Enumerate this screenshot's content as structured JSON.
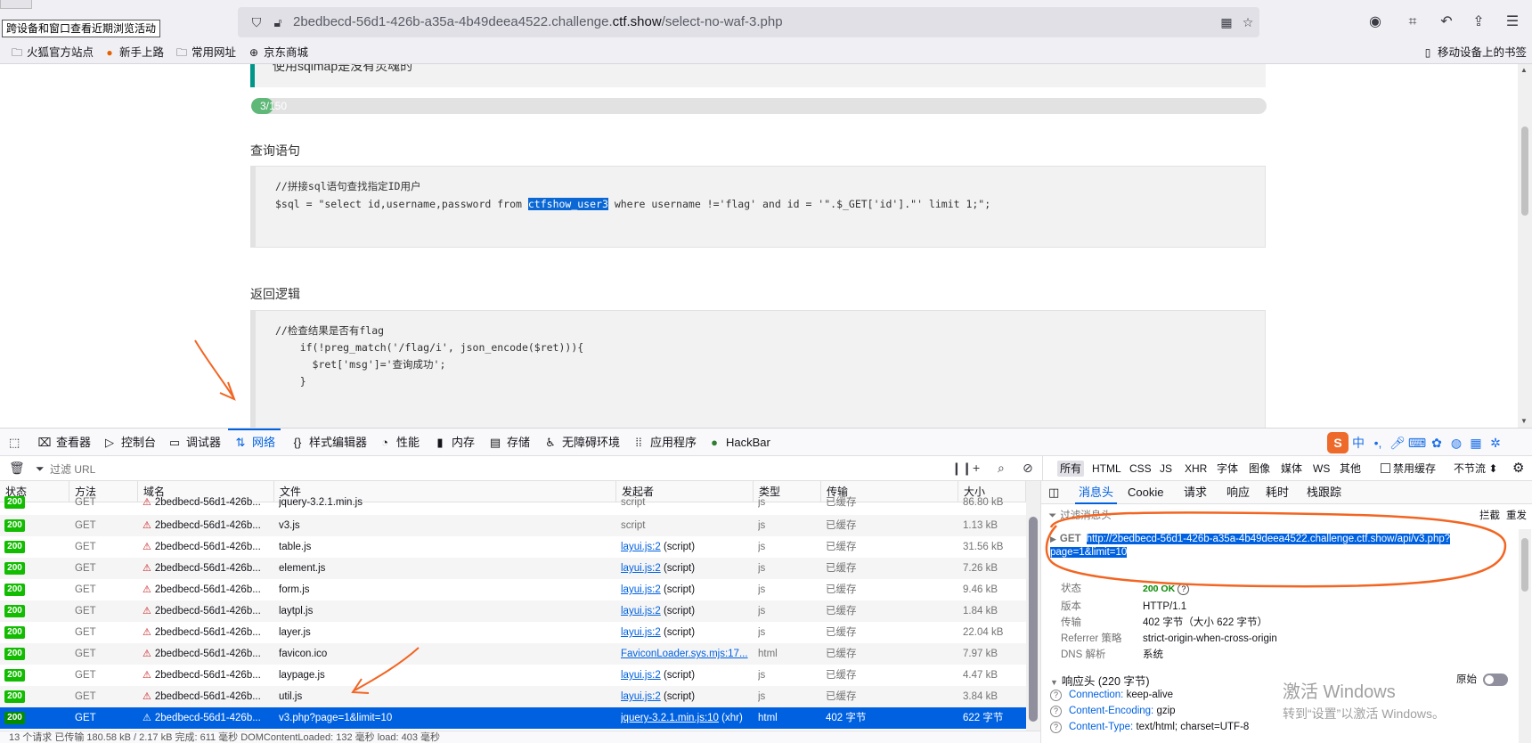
{
  "browser": {
    "tooltip": "跨设备和窗口查看近期浏览活动",
    "url_prefix": "2bedbecd-56d1-426b-a35a-4b49deea4522.challenge.",
    "url_domain": "ctf.show",
    "url_path": "/select-no-waf-3.php",
    "bookmarks": [
      "火狐官方站点",
      "新手上路",
      "常用网址",
      "京东商城"
    ],
    "mobile_bookmarks": "移动设备上的书签"
  },
  "page": {
    "note": "使用sqlmap是没有灵魂的",
    "progress": {
      "text": "3/150",
      "value": 3,
      "max": 150
    },
    "query_title": "查询语句",
    "query_comment": "//拼接sql语句查找指定ID用户",
    "query_pre": "$sql = \"select id,username,password from ",
    "query_highlight": "ctfshow_user3",
    "query_post": " where username !='flag' and id = '\".$_GET['id'].\"' limit 1;\";",
    "logic_title": "返回逻辑",
    "logic_lines": [
      "//检查结果是否有flag",
      "    if(!preg_match('/flag/i', json_encode($ret))){",
      "      $ret['msg']='查询成功';",
      "    }"
    ]
  },
  "devtools": {
    "tabs": [
      "查看器",
      "控制台",
      "调试器",
      "网络",
      "样式编辑器",
      "性能",
      "内存",
      "存储",
      "无障碍环境",
      "应用程序",
      "HackBar"
    ],
    "active_tab": "网络",
    "filter_placeholder": "过滤 URL",
    "type_filters": [
      "所有",
      "HTML",
      "CSS",
      "JS",
      "XHR",
      "字体",
      "图像",
      "媒体",
      "WS",
      "其他"
    ],
    "disable_cache": "禁用缓存",
    "throttle": "不节流",
    "columns": [
      "状态",
      "方法",
      "域名",
      "文件",
      "发起者",
      "类型",
      "传输",
      "大小"
    ],
    "requests": [
      {
        "status": "200",
        "method": "GET",
        "domain": "2bedbecd-56d1-426b...",
        "file": "jquery-3.2.1.min.js",
        "initiator": "script",
        "initiator_suffix": "",
        "type": "js",
        "transfer": "已缓存",
        "size": "86.80 kB"
      },
      {
        "status": "200",
        "method": "GET",
        "domain": "2bedbecd-56d1-426b...",
        "file": "v3.js",
        "initiator": "script",
        "initiator_suffix": "",
        "type": "js",
        "transfer": "已缓存",
        "size": "1.13 kB"
      },
      {
        "status": "200",
        "method": "GET",
        "domain": "2bedbecd-56d1-426b...",
        "file": "table.js",
        "initiator": "layui.js:2",
        "initiator_suffix": " (script)",
        "type": "js",
        "transfer": "已缓存",
        "size": "31.56 kB"
      },
      {
        "status": "200",
        "method": "GET",
        "domain": "2bedbecd-56d1-426b...",
        "file": "element.js",
        "initiator": "layui.js:2",
        "initiator_suffix": " (script)",
        "type": "js",
        "transfer": "已缓存",
        "size": "7.26 kB"
      },
      {
        "status": "200",
        "method": "GET",
        "domain": "2bedbecd-56d1-426b...",
        "file": "form.js",
        "initiator": "layui.js:2",
        "initiator_suffix": " (script)",
        "type": "js",
        "transfer": "已缓存",
        "size": "9.46 kB"
      },
      {
        "status": "200",
        "method": "GET",
        "domain": "2bedbecd-56d1-426b...",
        "file": "laytpl.js",
        "initiator": "layui.js:2",
        "initiator_suffix": " (script)",
        "type": "js",
        "transfer": "已缓存",
        "size": "1.84 kB"
      },
      {
        "status": "200",
        "method": "GET",
        "domain": "2bedbecd-56d1-426b...",
        "file": "layer.js",
        "initiator": "layui.js:2",
        "initiator_suffix": " (script)",
        "type": "js",
        "transfer": "已缓存",
        "size": "22.04 kB"
      },
      {
        "status": "200",
        "method": "GET",
        "domain": "2bedbecd-56d1-426b...",
        "file": "favicon.ico",
        "initiator": "FaviconLoader.sys.mjs:17...",
        "initiator_suffix": "",
        "type": "html",
        "transfer": "已缓存",
        "size": "7.97 kB"
      },
      {
        "status": "200",
        "method": "GET",
        "domain": "2bedbecd-56d1-426b...",
        "file": "laypage.js",
        "initiator": "layui.js:2",
        "initiator_suffix": " (script)",
        "type": "js",
        "transfer": "已缓存",
        "size": "4.47 kB"
      },
      {
        "status": "200",
        "method": "GET",
        "domain": "2bedbecd-56d1-426b...",
        "file": "util.js",
        "initiator": "layui.js:2",
        "initiator_suffix": " (script)",
        "type": "js",
        "transfer": "已缓存",
        "size": "3.84 kB"
      },
      {
        "status": "200",
        "method": "GET",
        "domain": "2bedbecd-56d1-426b...",
        "file": "v3.php?page=1&limit=10",
        "initiator": "jquery-3.2.1.min.js:10",
        "initiator_suffix": " (xhr)",
        "type": "html",
        "transfer": "402 字节",
        "size": "622 字节"
      }
    ],
    "statusbar": "13 个请求    已传输 180.58 kB / 2.17 kB    完成: 611 毫秒    DOMContentLoaded: 132 毫秒    load: 403 毫秒",
    "side_tabs": [
      "消息头",
      "Cookie",
      "请求",
      "响应",
      "耗时",
      "栈跟踪"
    ],
    "side_filter": "过滤消息头",
    "side_block": "拦截",
    "side_resend": "重发",
    "get_method": "GET",
    "get_url": "http://2bedbecd-56d1-426b-a35a-4b49deea4522.challenge.ctf.show/api/v3.php?page=1&limit=10",
    "info": [
      {
        "k": "状态",
        "v": "200 OK"
      },
      {
        "k": "版本",
        "v": "HTTP/1.1"
      },
      {
        "k": "传输",
        "v": "402 字节（大小 622 字节）"
      },
      {
        "k": "Referrer 策略",
        "v": "strict-origin-when-cross-origin"
      },
      {
        "k": "DNS 解析",
        "v": "系统"
      }
    ],
    "response_headers_title": "响应头 (220 字节)",
    "raw_label": "原始",
    "response_headers": [
      {
        "name": "Connection:",
        "value": "keep-alive"
      },
      {
        "name": "Content-Encoding:",
        "value": "gzip"
      },
      {
        "name": "Content-Type:",
        "value": "text/html; charset=UTF-8"
      }
    ]
  },
  "watermark": {
    "line1": "激活 Windows",
    "line2": "转到“设置”以激活 Windows。"
  },
  "colors": {
    "accent": "#0061e0",
    "status_ok": "#12bc00",
    "annotation": "#f26522",
    "progress": "#5fb878"
  }
}
